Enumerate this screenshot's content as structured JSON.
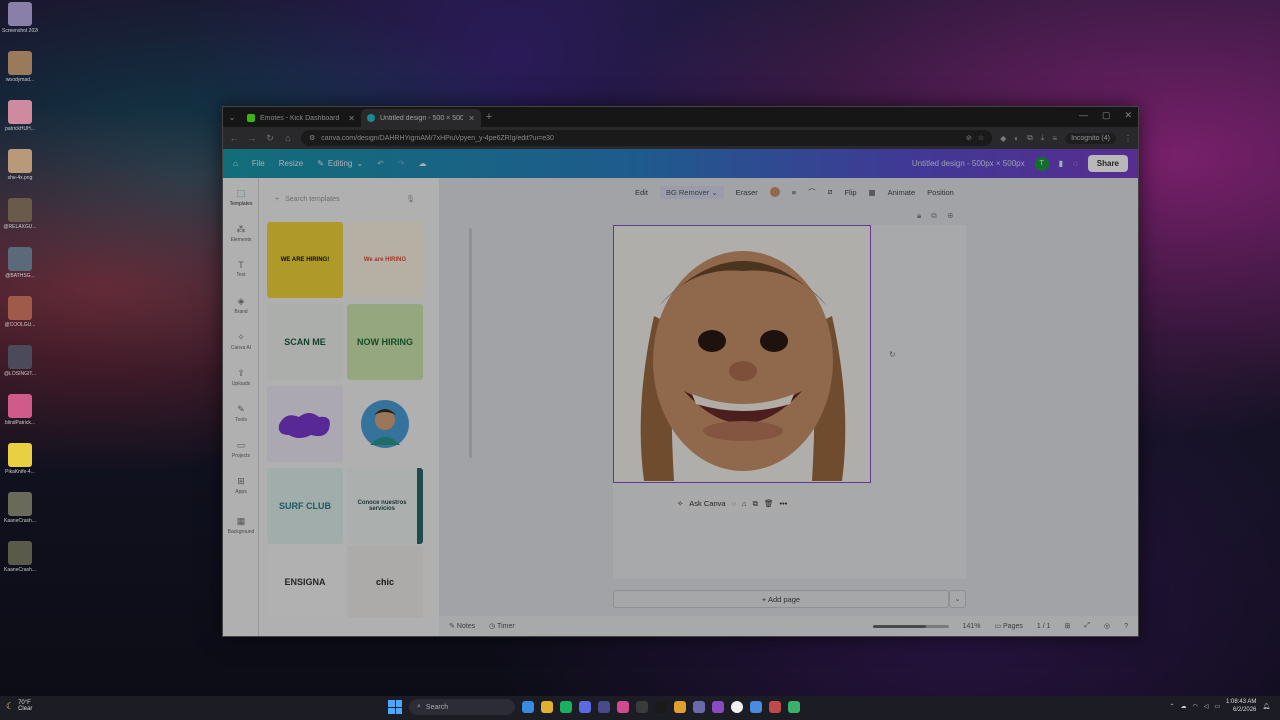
{
  "desktop": {
    "icons": [
      {
        "label": "Screenshot 2026-06-0...",
        "color": "#8a7fa8"
      },
      {
        "label": "woodymad...",
        "color": "#9a7a5a"
      },
      {
        "label": "patrickHUH...",
        "color": "#d08aa0"
      },
      {
        "label": "she-4x.png",
        "color": "#b89a7a"
      },
      {
        "label": "@RELAXGU...",
        "color": "#6a5a4a"
      },
      {
        "label": "@BATHSG...",
        "color": "#5a6a7a"
      },
      {
        "label": "@COOLGU...",
        "color": "#a05a4a"
      },
      {
        "label": "@LOSINGIT...",
        "color": "#4a4a5a"
      },
      {
        "label": "blindPatrick...",
        "color": "#d05a8a"
      },
      {
        "label": "PikaKnife-4...",
        "color": "#e8d040"
      },
      {
        "label": "KaaneCrash...",
        "color": "#6a6a5a"
      },
      {
        "label": "KaaneCrash...",
        "color": "#5a5a4a"
      }
    ]
  },
  "browser": {
    "tabs": [
      {
        "title": "Emotes - Kick Dashboard",
        "color": "#53fc18",
        "active": false
      },
      {
        "title": "Untitled design - 500 × 500px",
        "color": "#20c4cb",
        "active": true
      }
    ],
    "url": "canva.com/design/DAHRHYigmAM/7xHPiuVpyen_y-4pe6ZRIg/edit?ui=e30",
    "incognito_label": "Incognito (4)"
  },
  "canva": {
    "header": {
      "menu_file": "File",
      "menu_resize": "Resize",
      "menu_editing": "Editing",
      "design_title": "Untitled design - 500px × 500px",
      "avatar_letter": "T",
      "share_label": "Share"
    },
    "rail": [
      {
        "label": "Templates",
        "icon": "⬚",
        "active": true
      },
      {
        "label": "Elements",
        "icon": "⁂",
        "active": false
      },
      {
        "label": "Text",
        "icon": "T",
        "active": false
      },
      {
        "label": "Brand",
        "icon": "◈",
        "active": false
      },
      {
        "label": "Canva AI",
        "icon": "✧",
        "active": false
      },
      {
        "label": "Uploads",
        "icon": "⇪",
        "active": false
      },
      {
        "label": "Tools",
        "icon": "✎",
        "active": false
      },
      {
        "label": "Projects",
        "icon": "▭",
        "active": false
      },
      {
        "label": "Apps",
        "icon": "⊞",
        "active": false
      },
      {
        "label": "Background",
        "icon": "▦",
        "active": false
      }
    ],
    "search_placeholder": "Search templates",
    "templates": [
      {
        "text": "WE ARE HIRING!",
        "bg": "#f2d43a",
        "fg": "#111"
      },
      {
        "text": "We are HIRING",
        "bg": "#fbf3e4",
        "fg": "#e0503a"
      },
      {
        "text": "SCAN ME",
        "bg": "#eef2ee",
        "fg": "#1a5a3a"
      },
      {
        "text": "NOW HIRING",
        "bg": "#cfe8b0",
        "fg": "#1a6a3a"
      },
      {
        "text": "",
        "bg": "#efe9f7",
        "fg": "#6a2ac0"
      },
      {
        "text": "",
        "bg": "#f4f4f5",
        "fg": "#333"
      },
      {
        "text": "SURF CLUB",
        "bg": "#e0f0ee",
        "fg": "#2a7a8a"
      },
      {
        "text": "Conoce nuestros servicios",
        "bg": "#2a6a6a",
        "fg": "#2a4a4a"
      },
      {
        "text": "ENSIGNA",
        "bg": "#f6f6f6",
        "fg": "#333"
      },
      {
        "text": "chic",
        "bg": "#efeeea",
        "fg": "#222"
      }
    ],
    "toolbar": {
      "edit": "Edit",
      "bg_remover": "BG Remover",
      "eraser": "Eraser",
      "flip": "Flip",
      "animate": "Animate",
      "position": "Position"
    },
    "ask_canva": "Ask Canva",
    "add_page": "+ Add page",
    "footer": {
      "notes": "Notes",
      "timer": "Timer",
      "zoom_percent": 141,
      "zoom": "141%",
      "pages": "Pages",
      "page_count": "1 / 1"
    }
  },
  "taskbar": {
    "temperature": "70°F",
    "weather": "Clear",
    "search_placeholder": "Search",
    "time": "1:08:43 AM",
    "date": "6/2/2026",
    "apps": [
      "#3a8ae0",
      "#e0b030",
      "#1ab060",
      "#5a6ae0",
      "#4a4a8a",
      "#d04a90",
      "#3a3a3a",
      "#1a1a1a",
      "#e0a030",
      "#6a6aaa",
      "#8a4ac0",
      "#f0f0f0",
      "#4a8ae0",
      "#c04a4a",
      "#3ab06a"
    ]
  }
}
